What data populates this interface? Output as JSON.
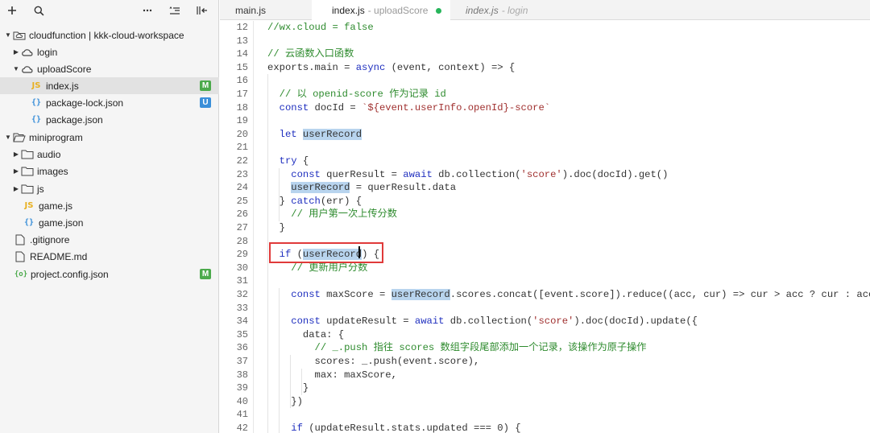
{
  "sidebar": {
    "toolbar": {
      "add_icon": "plus-icon",
      "search_icon": "search-icon",
      "more_icon": "more-icon",
      "sort_icon": "sort-icon",
      "collapse_icon": "collapse-panel-icon"
    },
    "tree": [
      {
        "label": "cloudfunction | kkk-cloud-workspace",
        "icon": "cloud-folder-icon",
        "arrow": "▼",
        "badge": ""
      },
      {
        "label": "login",
        "icon": "cloud-icon",
        "arrow": "▶",
        "badge": ""
      },
      {
        "label": "uploadScore",
        "icon": "cloud-icon",
        "arrow": "▼",
        "badge": ""
      },
      {
        "label": "index.js",
        "icon": "js-file-icon",
        "arrow": "",
        "badge": "M"
      },
      {
        "label": "package-lock.json",
        "icon": "json-file-icon",
        "arrow": "",
        "badge": "U"
      },
      {
        "label": "package.json",
        "icon": "json-file-icon",
        "arrow": "",
        "badge": ""
      },
      {
        "label": "miniprogram",
        "icon": "folder-open-icon",
        "arrow": "▼",
        "badge": ""
      },
      {
        "label": "audio",
        "icon": "folder-icon",
        "arrow": "▶",
        "badge": ""
      },
      {
        "label": "images",
        "icon": "folder-icon",
        "arrow": "▶",
        "badge": ""
      },
      {
        "label": "js",
        "icon": "folder-icon",
        "arrow": "▶",
        "badge": ""
      },
      {
        "label": "game.js",
        "icon": "js-file-icon",
        "arrow": "",
        "badge": ""
      },
      {
        "label": "game.json",
        "icon": "json-file-icon",
        "arrow": "",
        "badge": ""
      },
      {
        "label": ".gitignore",
        "icon": "file-icon",
        "arrow": "",
        "badge": ""
      },
      {
        "label": "README.md",
        "icon": "file-icon",
        "arrow": "",
        "badge": ""
      },
      {
        "label": "project.config.json",
        "icon": "config-file-icon",
        "arrow": "",
        "badge": "M"
      }
    ]
  },
  "tabs": [
    {
      "label": "main.js",
      "sub": ""
    },
    {
      "label": "index.js",
      "sub": "- uploadScore"
    },
    {
      "label": "index.js",
      "sub": "- login"
    }
  ],
  "editor": {
    "line_numbers": [
      "12",
      "13",
      "14",
      "15",
      "16",
      "17",
      "18",
      "19",
      "20",
      "21",
      "22",
      "23",
      "24",
      "25",
      "26",
      "27",
      "28",
      "29",
      "30",
      "31",
      "32",
      "33",
      "34",
      "35",
      "36",
      "37",
      "38",
      "39",
      "40",
      "41",
      "42"
    ],
    "lines": [
      "//wx.cloud = false",
      "",
      "// 云函数入口函数",
      "exports.main = async (event, context) => {",
      "",
      "  // 以 openid-score 作为记录 id",
      "  const docId = `${event.userInfo.openId}-score`",
      "",
      "  let userRecord",
      "",
      "  try {",
      "    const querResult = await db.collection('score').doc(docId).get()",
      "    userRecord = querResult.data",
      "  } catch(err) {",
      "    // 用户第一次上传分数",
      "  }",
      "",
      "  if (userRecord) {",
      "    // 更新用户分数",
      "",
      "    const maxScore = userRecord.scores.concat([event.score]).reduce((acc, cur) => cur > acc ? cur : acc)",
      "",
      "    const updateResult = await db.collection('score').doc(docId).update({",
      "      data: {",
      "        // _.push 指往 scores 数组字段尾部添加一个记录，该操作为原子操作",
      "        scores: _.push(event.score),",
      "        max: maxScore,",
      "      }",
      "    })",
      "",
      "    if (updateResult.stats.updated === 0) {"
    ]
  },
  "colors": {
    "keyword": "#1f2fbf",
    "string": "#a0302f",
    "comment": "#2e8b2e",
    "selection": "#b8d4ee",
    "highlight_box": "#e03a3a",
    "badge_m": "#4caa4c",
    "badge_u": "#3a8fd9",
    "modified_dot": "#27b55b"
  }
}
